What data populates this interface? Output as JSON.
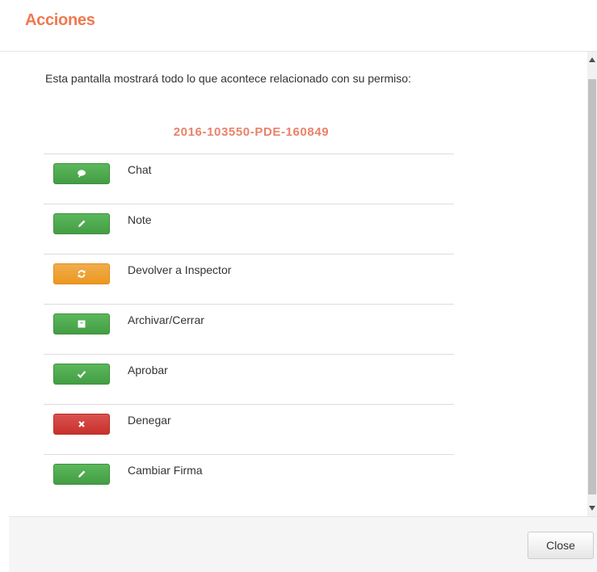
{
  "dialog": {
    "title": "Acciones",
    "intro": "Esta pantalla mostrará todo lo que acontece relacionado con su permiso:",
    "permit_number": "2016-103550-PDE-160849"
  },
  "actions": [
    {
      "label": "Chat",
      "icon": "comment-icon",
      "style": "success"
    },
    {
      "label": "Note",
      "icon": "pencil-icon",
      "style": "success"
    },
    {
      "label": "Devolver a Inspector",
      "icon": "refresh-icon",
      "style": "warning"
    },
    {
      "label": "Archivar/Cerrar",
      "icon": "archive-icon",
      "style": "success"
    },
    {
      "label": "Aprobar",
      "icon": "check-icon",
      "style": "success"
    },
    {
      "label": "Denegar",
      "icon": "close-icon",
      "style": "danger"
    },
    {
      "label": "Cambiar Firma",
      "icon": "pencil-icon",
      "style": "success"
    }
  ],
  "footer": {
    "close_label": "Close"
  },
  "colors": {
    "title": "#f0784f",
    "permit": "#e9826a",
    "success": "#5cb85c",
    "warning": "#f0ad4e",
    "danger": "#d9534f"
  }
}
